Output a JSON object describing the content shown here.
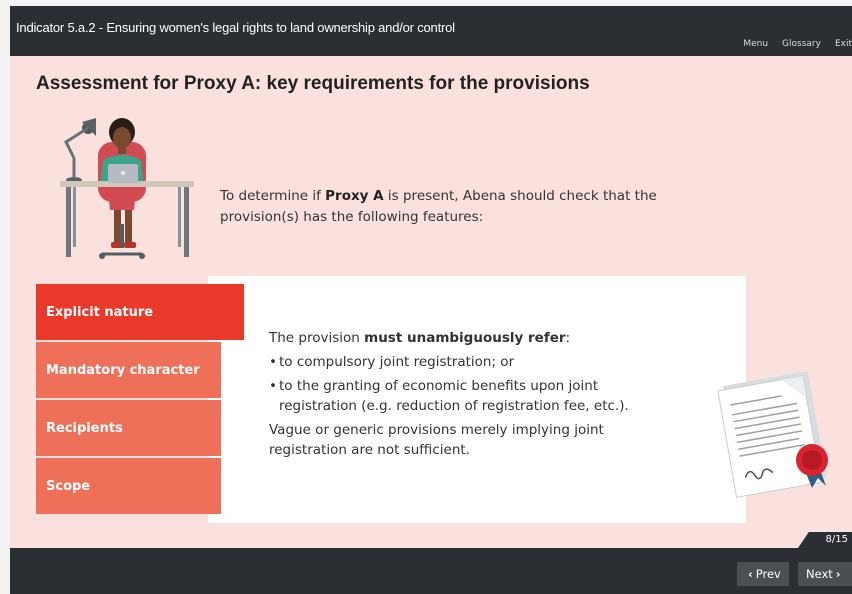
{
  "course": {
    "title": "Indicator 5.a.2 - Ensuring women's legal rights to land ownership and/or control"
  },
  "topnav": {
    "menu": "Menu",
    "glossary": "Glossary",
    "exit": "Exit"
  },
  "slide": {
    "title": "Assessment for Proxy A: key requirements for the provisions",
    "intro_before": "To determine if ",
    "intro_bold": "Proxy A",
    "intro_after": " is present, Abena should check that the provision(s) has the following features:"
  },
  "tabs": [
    {
      "label": "Explicit nature",
      "active": true
    },
    {
      "label": "Mandatory character",
      "active": false
    },
    {
      "label": "Recipients",
      "active": false
    },
    {
      "label": "Scope",
      "active": false
    }
  ],
  "panel": {
    "lead_before": "The provision ",
    "lead_bold": "must unambiguously refer",
    "lead_after": ":",
    "bullets": [
      "to compulsory joint registration; or",
      "to the granting of economic benefits upon joint registration (e.g. reduction of registration fee, etc.)."
    ],
    "closing": "Vague or generic provisions merely implying joint registration are not sufficient."
  },
  "footer": {
    "page": "8/15",
    "prev": "Prev",
    "next": "Next"
  },
  "icons": {
    "prev": "chevron-left-icon",
    "next": "chevron-right-icon",
    "illustration": "woman-at-desk-illustration",
    "document": "signed-certificate-icon"
  },
  "colors": {
    "active_tab": "#e8392a",
    "inactive_tab": "#ef7059",
    "slide_bg": "#fbe1de",
    "chrome": "#2b2f33"
  }
}
